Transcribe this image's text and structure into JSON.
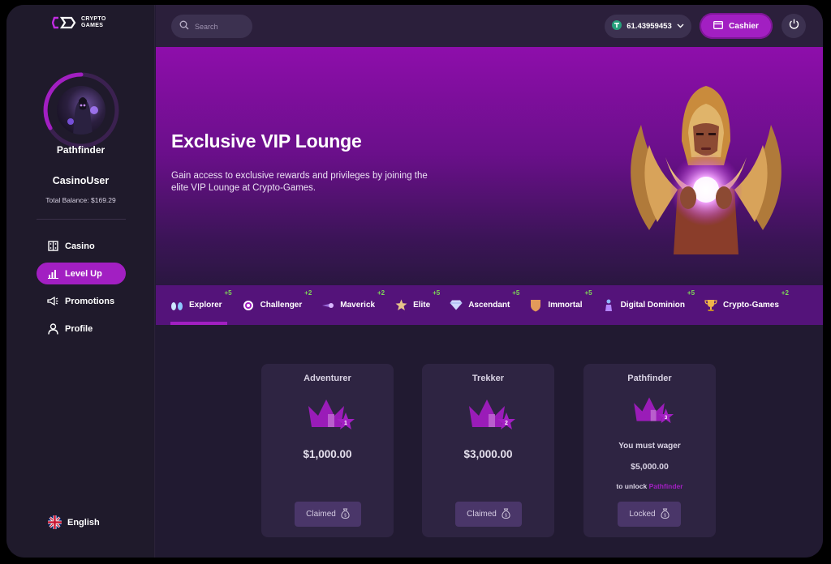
{
  "brand": {
    "line1": "CRYPTO",
    "line2": "GAMES"
  },
  "sidebar": {
    "rank_name": "Pathfinder",
    "username": "CasinoUser",
    "balance": "Total Balance: $169.29",
    "nav": [
      {
        "label": "Casino",
        "icon": "casino-icon"
      },
      {
        "label": "Level Up",
        "icon": "level-up-icon",
        "active": true
      },
      {
        "label": "Promotions",
        "icon": "megaphone-icon"
      },
      {
        "label": "Profile",
        "icon": "user-icon"
      }
    ],
    "language": "English"
  },
  "topbar": {
    "search_placeholder": "Search",
    "wallet_amount": "61.43959453",
    "cashier_label": "Cashier"
  },
  "hero": {
    "title": "Exclusive VIP Lounge",
    "description": "Gain access to exclusive rewards and privileges by joining the elite VIP Lounge at Crypto-Games."
  },
  "tabs": [
    {
      "label": "Explorer",
      "bonus": "+5",
      "active": true
    },
    {
      "label": "Challenger",
      "bonus": "+2"
    },
    {
      "label": "Maverick",
      "bonus": "+2"
    },
    {
      "label": "Elite",
      "bonus": "+5"
    },
    {
      "label": "Ascendant",
      "bonus": "+5"
    },
    {
      "label": "Immortal",
      "bonus": "+5"
    },
    {
      "label": "Digital Dominion",
      "bonus": "+5"
    },
    {
      "label": "Crypto-Games",
      "bonus": "+2"
    }
  ],
  "cards": [
    {
      "title": "Adventurer",
      "level": "1",
      "amount": "$1,000.00",
      "button": "Claimed"
    },
    {
      "title": "Trekker",
      "level": "2",
      "amount": "$3,000.00",
      "button": "Claimed"
    },
    {
      "title": "Pathfinder",
      "level": "3",
      "wager_text": "You must wager",
      "wager_amount": "$5,000.00",
      "unlock_prefix": "to unlock",
      "unlock_name": "Pathfinder",
      "button": "Locked"
    }
  ],
  "colors": {
    "accent": "#a21fc2",
    "bonus": "#7ed957",
    "tab_bar": "#54137a"
  }
}
